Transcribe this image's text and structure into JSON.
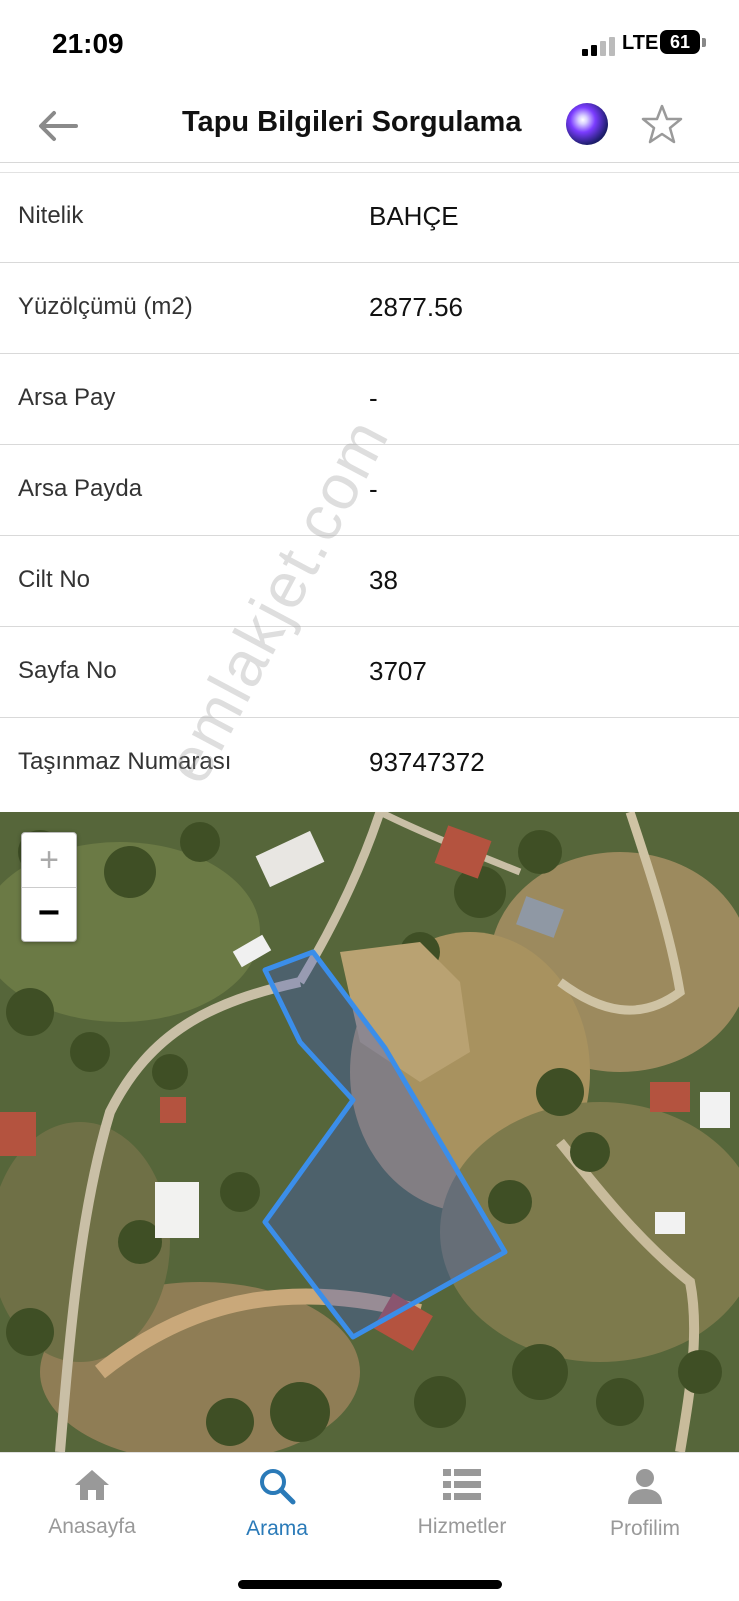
{
  "status_bar": {
    "time": "21:09",
    "network": "LTE",
    "battery": "61"
  },
  "header": {
    "title": "Tapu Bilgileri Sorgulama"
  },
  "info_rows": [
    {
      "label": "Nitelik",
      "value": "BAHÇE"
    },
    {
      "label": "Yüzölçümü (m2)",
      "value": "2877.56"
    },
    {
      "label": "Arsa Pay",
      "value": "-"
    },
    {
      "label": "Arsa Payda",
      "value": "-"
    },
    {
      "label": "Cilt No",
      "value": "38"
    },
    {
      "label": "Sayfa No",
      "value": "3707"
    },
    {
      "label": "Taşınmaz Numarası",
      "value": "93747372"
    }
  ],
  "map": {
    "zoom_in": "+",
    "zoom_out": "−",
    "parcel_color": "#3b8eea"
  },
  "watermark": "emlakjet.com",
  "bottom_nav": [
    {
      "label": "Anasayfa",
      "icon": "home-icon",
      "active": false
    },
    {
      "label": "Arama",
      "icon": "search-icon",
      "active": true
    },
    {
      "label": "Hizmetler",
      "icon": "list-icon",
      "active": false
    },
    {
      "label": "Profilim",
      "icon": "person-icon",
      "active": false
    }
  ],
  "colors": {
    "accent": "#2a7ab8",
    "inactive": "#999999"
  }
}
